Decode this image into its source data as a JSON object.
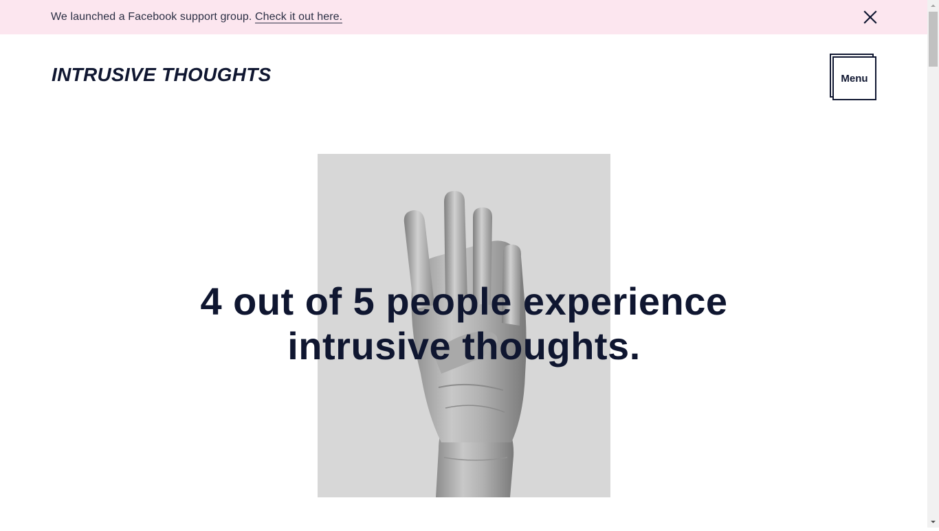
{
  "announcement": {
    "text": "We launched a Facebook support group. ",
    "link_text": "Check it out here.",
    "close_icon": "close-icon"
  },
  "header": {
    "logo_text": "INTRUSIVE THOUGHTS",
    "menu_label": "Menu"
  },
  "hero": {
    "image_subject": "raised hand showing four fingers",
    "heading": "4 out of 5 people experience intrusive thoughts."
  },
  "colors": {
    "announcement_bg": "#fce6ef",
    "text_primary": "#0f1630",
    "image_bg": "#d7d7d7"
  }
}
